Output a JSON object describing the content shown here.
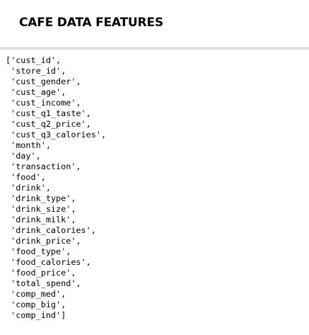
{
  "heading": "CAFE DATA FEATURES",
  "output_lines": [
    "['cust_id',",
    " 'store_id',",
    " 'cust_gender',",
    " 'cust_age',",
    " 'cust_income',",
    " 'cust_q1_taste',",
    " 'cust_q2_price',",
    " 'cust_q3_calories',",
    " 'month',",
    " 'day',",
    " 'transaction',",
    " 'food',",
    " 'drink',",
    " 'drink_type',",
    " 'drink_size',",
    " 'drink_milk',",
    " 'drink_calories',",
    " 'drink_price',",
    " 'food_type',",
    " 'food_calories',",
    " 'food_price',",
    " 'total_spend',",
    " 'comp_med',",
    " 'comp_big',",
    " 'comp_ind']"
  ]
}
